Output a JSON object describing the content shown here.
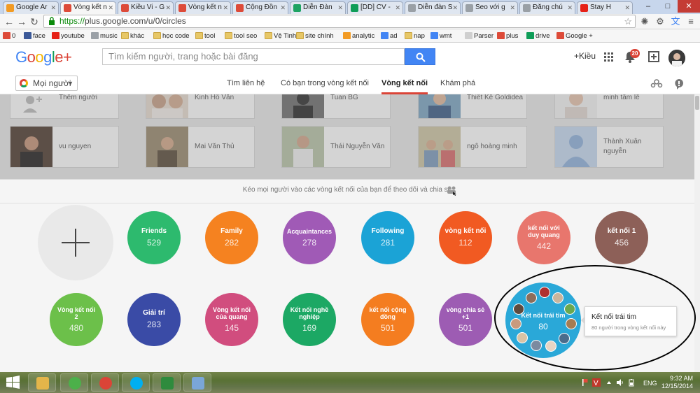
{
  "browser": {
    "tabs": [
      {
        "label": "Google Ar",
        "favicon_color": "#f29b24"
      },
      {
        "label": "Vòng kết n",
        "favicon_color": "#dd4b39",
        "active": true
      },
      {
        "label": "Kiều Vi - G",
        "favicon_color": "#dd4b39"
      },
      {
        "label": "Vòng kết n",
        "favicon_color": "#dd4b39"
      },
      {
        "label": "Cộng Đồn",
        "favicon_color": "#dd4b39"
      },
      {
        "label": "Diễn Đàn",
        "favicon_color": "#1ea362"
      },
      {
        "label": "[DD] CV -",
        "favicon_color": "#0f9d58"
      },
      {
        "label": "Diễn đàn S",
        "favicon_color": "#9aa0a6"
      },
      {
        "label": "Seo với g",
        "favicon_color": "#9aa0a6"
      },
      {
        "label": "Đăng chú",
        "favicon_color": "#9aa0a6"
      },
      {
        "label": "Stay H",
        "favicon_color": "#e62117"
      }
    ],
    "window_controls": {
      "minimize": "–",
      "maximize": "□",
      "close": "✕"
    },
    "url_scheme": "https://",
    "url_rest": "plus.google.com/u/0/circles",
    "bookmarks": [
      {
        "label": "0",
        "icon": "google-plus-icon",
        "color": "#dd4b39"
      },
      {
        "label": "face",
        "icon": "facebook-icon",
        "color": "#3b5998"
      },
      {
        "label": "youtube",
        "icon": "youtube-icon",
        "color": "#e62117"
      },
      {
        "label": "music",
        "icon": "music-icon",
        "color": "#9aa0a6"
      },
      {
        "label": "khác",
        "icon": "folder-icon",
        "color": "#e7c766"
      },
      {
        "label": "học code",
        "icon": "folder-icon",
        "color": "#e7c766"
      },
      {
        "label": "tool",
        "icon": "folder-icon",
        "color": "#e7c766"
      },
      {
        "label": "tool seo",
        "icon": "folder-icon",
        "color": "#e7c766"
      },
      {
        "label": "Vệ Tinh",
        "icon": "folder-icon",
        "color": "#e7c766"
      },
      {
        "label": "site chính",
        "icon": "folder-icon",
        "color": "#e7c766"
      },
      {
        "label": "analytic",
        "icon": "analytics-icon",
        "color": "#f29b24"
      },
      {
        "label": "ad",
        "icon": "adwords-icon",
        "color": "#4285f4"
      },
      {
        "label": "nap",
        "icon": "folder-icon",
        "color": "#e7c766"
      },
      {
        "label": "wmt",
        "icon": "webmaster-icon",
        "color": "#4285f4"
      },
      {
        "label": "Parser",
        "icon": "page-icon",
        "color": "#cfcfcf"
      },
      {
        "label": "plus",
        "icon": "google-plus-icon",
        "color": "#dd4b39"
      },
      {
        "label": "drive",
        "icon": "drive-icon",
        "color": "#0f9d58"
      },
      {
        "label": "Google +",
        "icon": "google-plus-icon",
        "color": "#dd4b39"
      }
    ]
  },
  "header": {
    "logo_parts": [
      "G",
      "o",
      "o",
      "g",
      "l",
      "e",
      "+"
    ],
    "search_placeholder": "Tìm kiếm người, trang hoặc bài đăng",
    "user_link": "+Kiều",
    "notification_count": "20"
  },
  "subnav": {
    "scope_label": "Mọi người",
    "tabs": [
      {
        "label": "Tìm liên hệ"
      },
      {
        "label": "Có bạn trong vòng kết nối"
      },
      {
        "label": "Vòng kết nối",
        "active": true
      },
      {
        "label": "Khám phá"
      }
    ]
  },
  "people": {
    "row1": [
      {
        "name": "Thêm người"
      },
      {
        "name": "Kinh Hồ Văn"
      },
      {
        "name": "Tuan BG"
      },
      {
        "name": "Thiết Kế Goldidea"
      },
      {
        "name": "minh tâm lê"
      }
    ],
    "row2": [
      {
        "name": "vu nguyen"
      },
      {
        "name": "Mai Văn Thủ"
      },
      {
        "name": "Thái Nguyễn Văn"
      },
      {
        "name": "ngô hoàng minh"
      },
      {
        "name": "Thành Xuân nguyễn"
      }
    ]
  },
  "tray": {
    "hint": "Kéo mọi người vào các vòng kết nối của bạn để theo dõi và chia sẻ",
    "circles": [
      {
        "name": "Friends",
        "count": "529",
        "color": "#2dba6e"
      },
      {
        "name": "Family",
        "count": "282",
        "color": "#f58220"
      },
      {
        "name": "Acquaintances",
        "count": "278",
        "color": "#a05ab6"
      },
      {
        "name": "Following",
        "count": "281",
        "color": "#1ba3d6"
      },
      {
        "name": "vòng kết nối",
        "count": "112",
        "color": "#f15a22"
      },
      {
        "name": "kết nối với duy quang",
        "count": "442",
        "color": "#e8766d"
      },
      {
        "name": "kết nối 1",
        "count": "456",
        "color": "#8d6058"
      },
      {
        "name": "Vòng kết nối 2",
        "count": "480",
        "color": "#6cc04a"
      },
      {
        "name": "Giải trí",
        "count": "283",
        "color": "#3a4ba6"
      },
      {
        "name": "Vòng kết nối của quang",
        "count": "145",
        "color": "#d14d7e"
      },
      {
        "name": "Kết nối nghề nghiệp",
        "count": "169",
        "color": "#1ca864"
      },
      {
        "name": "kết nối cộng đồng",
        "count": "501",
        "color": "#f47d20"
      },
      {
        "name": "vòng chia sẻ +1",
        "count": "501",
        "color": "#9d5cb3"
      }
    ],
    "selected_circle": {
      "name": "Kết nối trái tim",
      "count": "80",
      "color": "#2aa8d8"
    },
    "tooltip": {
      "title": "Kết nối trái tim",
      "subtitle": "80 người trong vòng kết nối này"
    }
  },
  "taskbar": {
    "apps": [
      {
        "icon": "file-explorer-icon",
        "color": "#e3b54a"
      },
      {
        "icon": "coccoc-icon",
        "color": "#4cb04a"
      },
      {
        "icon": "chrome-icon",
        "color": "#db4437"
      },
      {
        "icon": "skype-icon",
        "color": "#00aff0"
      },
      {
        "icon": "seo-tool-icon",
        "color": "#2e8b3d"
      },
      {
        "icon": "paint-icon",
        "color": "#7aa6d8"
      }
    ],
    "language": "ENG",
    "time": "9:32 AM",
    "date": "12/15/2014"
  }
}
